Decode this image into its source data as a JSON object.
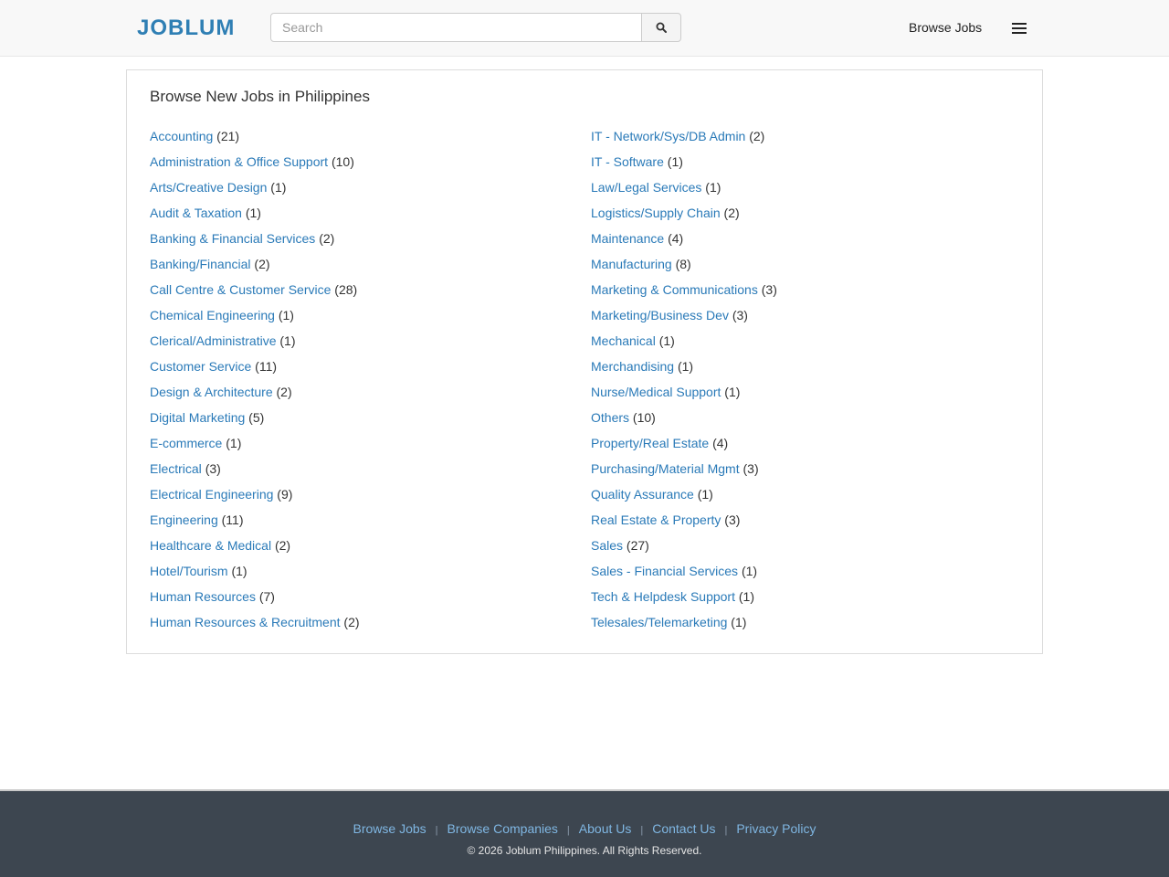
{
  "header": {
    "logo": "JOBLUM",
    "search_placeholder": "Search",
    "browse_jobs": "Browse Jobs",
    "search_icon": "search-icon",
    "menu_icon": "hamburger-menu-icon"
  },
  "panel": {
    "title": "Browse New Jobs in Philippines",
    "left": [
      {
        "name": "Accounting",
        "count": "(21)"
      },
      {
        "name": "Administration & Office Support",
        "count": "(10)"
      },
      {
        "name": "Arts/Creative Design",
        "count": "(1)"
      },
      {
        "name": "Audit & Taxation",
        "count": "(1)"
      },
      {
        "name": "Banking & Financial Services",
        "count": "(2)"
      },
      {
        "name": "Banking/Financial",
        "count": "(2)"
      },
      {
        "name": "Call Centre & Customer Service",
        "count": "(28)"
      },
      {
        "name": "Chemical Engineering",
        "count": "(1)"
      },
      {
        "name": "Clerical/Administrative",
        "count": "(1)"
      },
      {
        "name": "Customer Service",
        "count": "(11)"
      },
      {
        "name": "Design & Architecture",
        "count": "(2)"
      },
      {
        "name": "Digital Marketing",
        "count": "(5)"
      },
      {
        "name": "E-commerce",
        "count": "(1)"
      },
      {
        "name": "Electrical",
        "count": "(3)"
      },
      {
        "name": "Electrical Engineering",
        "count": "(9)"
      },
      {
        "name": "Engineering",
        "count": "(11)"
      },
      {
        "name": "Healthcare & Medical",
        "count": "(2)"
      },
      {
        "name": "Hotel/Tourism",
        "count": "(1)"
      },
      {
        "name": "Human Resources",
        "count": "(7)"
      },
      {
        "name": "Human Resources & Recruitment",
        "count": "(2)"
      }
    ],
    "right": [
      {
        "name": "IT - Network/Sys/DB Admin",
        "count": "(2)"
      },
      {
        "name": "IT - Software",
        "count": "(1)"
      },
      {
        "name": "Law/Legal Services",
        "count": "(1)"
      },
      {
        "name": "Logistics/Supply Chain",
        "count": "(2)"
      },
      {
        "name": "Maintenance",
        "count": "(4)"
      },
      {
        "name": "Manufacturing",
        "count": "(8)"
      },
      {
        "name": "Marketing & Communications",
        "count": "(3)"
      },
      {
        "name": "Marketing/Business Dev",
        "count": "(3)"
      },
      {
        "name": "Mechanical",
        "count": "(1)"
      },
      {
        "name": "Merchandising",
        "count": "(1)"
      },
      {
        "name": "Nurse/Medical Support",
        "count": "(1)"
      },
      {
        "name": "Others",
        "count": "(10)"
      },
      {
        "name": "Property/Real Estate",
        "count": "(4)"
      },
      {
        "name": "Purchasing/Material Mgmt",
        "count": "(3)"
      },
      {
        "name": "Quality Assurance",
        "count": "(1)"
      },
      {
        "name": "Real Estate & Property",
        "count": "(3)"
      },
      {
        "name": "Sales",
        "count": "(27)"
      },
      {
        "name": "Sales - Financial Services",
        "count": "(1)"
      },
      {
        "name": "Tech & Helpdesk Support",
        "count": "(1)"
      },
      {
        "name": "Telesales/Telemarketing",
        "count": "(1)"
      }
    ]
  },
  "footer": {
    "links": [
      "Browse Jobs",
      "Browse Companies",
      "About Us",
      "Contact Us",
      "Privacy Policy"
    ],
    "separator": "|",
    "copyright": "© 2026 Joblum Philippines. All Rights Reserved."
  },
  "colors": {
    "link": "#2a7ab8",
    "logo": "#2f7fb4",
    "footer_bg": "#3d4650",
    "footer_link": "#7fb6e2"
  }
}
